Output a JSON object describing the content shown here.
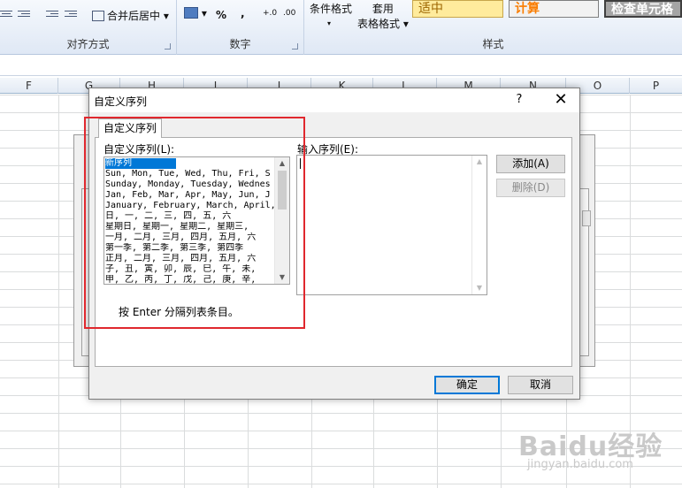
{
  "ribbon": {
    "merge_center_label": "合并后居中",
    "alignment_group": "对齐方式",
    "number_format_label": "%",
    "number_comma_label": ",",
    "number_group": "数字",
    "conditional_format_label": "条件格式",
    "table_format_label_1": "套用",
    "table_format_label_2": "表格格式",
    "styles_group": "样式",
    "style_neutral": "适中",
    "style_calc": "计算",
    "style_check": "检查单元格",
    "dec_inc": "+.0",
    "dec_dec": ".00"
  },
  "columns": [
    "F",
    "G",
    "H",
    "I",
    "J",
    "K",
    "L",
    "M",
    "N",
    "O",
    "P"
  ],
  "dialog": {
    "title": "自定义序列",
    "help": "?",
    "close": "✕",
    "tab_label": "自定义序列",
    "list_label": "自定义序列(L):",
    "input_label": "输入序列(E):",
    "list_items": [
      "新序列",
      "Sun, Mon, Tue, Wed, Thu, Fri, S",
      "Sunday, Monday, Tuesday, Wednes",
      "Jan, Feb, Mar, Apr, May, Jun, J",
      "January, February, March, April,",
      "日, 一, 二, 三, 四, 五, 六",
      "星期日, 星期一, 星期二, 星期三,",
      "一月, 二月, 三月, 四月, 五月, 六",
      "第一季, 第二季, 第三季, 第四季",
      "正月, 二月, 三月, 四月, 五月, 六",
      "子, 丑, 寅, 卯, 辰, 巳, 午, 未,",
      "甲, 乙, 丙, 丁, 戊, 己, 庚, 辛,"
    ],
    "add_button": "添加(A)",
    "delete_button": "删除(D)",
    "hint": "按 Enter 分隔列表条目。",
    "ok_button": "确定",
    "cancel_button": "取消"
  },
  "colors": {
    "highlight": "#e0282e",
    "selection": "#0078d7"
  },
  "watermark": {
    "text": "Baidu经验",
    "url": "jingyan.baidu.com"
  }
}
